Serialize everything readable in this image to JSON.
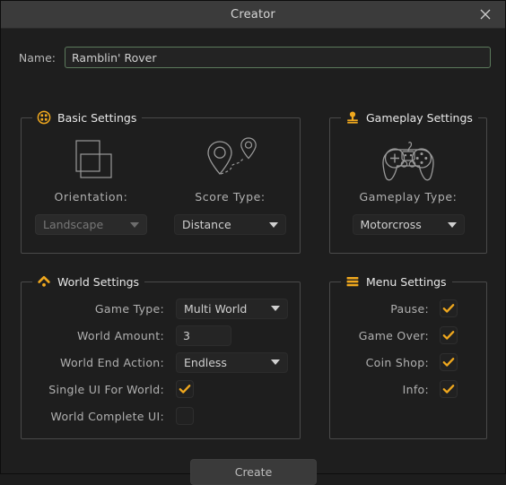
{
  "window": {
    "title": "Creator",
    "close_icon": "close-x-icon"
  },
  "name_field": {
    "label": "Name:",
    "value": "Ramblin' Rover",
    "placeholder": "Name",
    "border_color": "#5c7a5c"
  },
  "groups": {
    "basic": {
      "title": "Basic Settings",
      "icon": "apps-grid-circle-icon",
      "orientation": {
        "label": "Orientation:",
        "illustration_icon": "overlapping-rectangles-icon",
        "value": "Landscape",
        "disabled": true
      },
      "score_type": {
        "label": "Score Type:",
        "illustration_icon": "map-pins-route-icon",
        "value": "Distance",
        "disabled": false
      }
    },
    "gameplay": {
      "title": "Gameplay Settings",
      "icon": "joystick-icon",
      "gameplay_type": {
        "label": "Gameplay Type:",
        "illustration_icon": "gamepad-icon",
        "value": "Motorcross",
        "disabled": false
      }
    },
    "world": {
      "title": "World Settings",
      "icon": "chevron-up-dot-icon",
      "rows": [
        {
          "label": "Game Type:",
          "type": "combo",
          "value": "Multi World"
        },
        {
          "label": "World Amount:",
          "type": "number",
          "value": "3"
        },
        {
          "label": "World End Action:",
          "type": "combo",
          "value": "Endless"
        },
        {
          "label": "Single UI For World:",
          "type": "checkbox",
          "checked": true
        },
        {
          "label": "World Complete UI:",
          "type": "checkbox",
          "checked": false
        }
      ]
    },
    "menu": {
      "title": "Menu Settings",
      "icon": "hamburger-menu-icon",
      "rows": [
        {
          "label": "Pause:",
          "checked": true
        },
        {
          "label": "Game Over:",
          "checked": true
        },
        {
          "label": "Coin Shop:",
          "checked": true
        },
        {
          "label": "Info:",
          "checked": true
        }
      ]
    }
  },
  "footer": {
    "create_label": "Create"
  },
  "colors": {
    "accent_orange": "#f0a81e",
    "window_bg": "#1e1e1e",
    "titlebar_bg": "#3b3b3b",
    "group_border": "#4a4a4a",
    "input_bg": "#252525"
  }
}
